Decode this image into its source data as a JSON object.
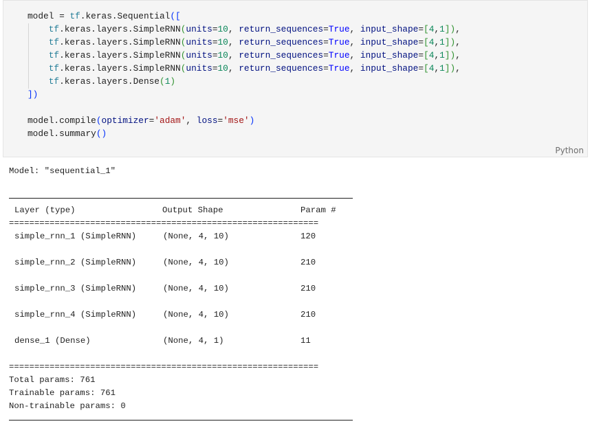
{
  "code_cell": {
    "language_label": "Python",
    "lines": [
      {
        "parts": [
          [
            "model = ",
            ""
          ],
          [
            "tf",
            "tf"
          ],
          [
            ".keras.Sequential",
            ""
          ],
          [
            "([",
            "br1"
          ]
        ]
      },
      {
        "indent": true,
        "parts": [
          [
            "tf",
            "tf"
          ],
          [
            ".keras.layers.SimpleRNN",
            ""
          ],
          [
            "(",
            "br2"
          ],
          [
            "units",
            "var"
          ],
          [
            "=",
            ""
          ],
          [
            "10",
            "num"
          ],
          [
            ", ",
            ""
          ],
          [
            "return_sequences",
            "var"
          ],
          [
            "=",
            ""
          ],
          [
            "True",
            "const"
          ],
          [
            ", ",
            ""
          ],
          [
            "input_shape",
            "var"
          ],
          [
            "=",
            ""
          ],
          [
            "[",
            "br2"
          ],
          [
            "4",
            "num"
          ],
          [
            ",",
            ""
          ],
          [
            "1",
            "num"
          ],
          [
            "]",
            "br2"
          ],
          [
            ")",
            "br2"
          ],
          [
            ",",
            ""
          ]
        ]
      },
      {
        "indent": true,
        "parts": [
          [
            "tf",
            "tf"
          ],
          [
            ".keras.layers.SimpleRNN",
            ""
          ],
          [
            "(",
            "br2"
          ],
          [
            "units",
            "var"
          ],
          [
            "=",
            ""
          ],
          [
            "10",
            "num"
          ],
          [
            ", ",
            ""
          ],
          [
            "return_sequences",
            "var"
          ],
          [
            "=",
            ""
          ],
          [
            "True",
            "const"
          ],
          [
            ", ",
            ""
          ],
          [
            "input_shape",
            "var"
          ],
          [
            "=",
            ""
          ],
          [
            "[",
            "br2"
          ],
          [
            "4",
            "num"
          ],
          [
            ",",
            ""
          ],
          [
            "1",
            "num"
          ],
          [
            "]",
            "br2"
          ],
          [
            ")",
            "br2"
          ],
          [
            ",",
            ""
          ]
        ]
      },
      {
        "indent": true,
        "parts": [
          [
            "tf",
            "tf"
          ],
          [
            ".keras.layers.SimpleRNN",
            ""
          ],
          [
            "(",
            "br2"
          ],
          [
            "units",
            "var"
          ],
          [
            "=",
            ""
          ],
          [
            "10",
            "num"
          ],
          [
            ", ",
            ""
          ],
          [
            "return_sequences",
            "var"
          ],
          [
            "=",
            ""
          ],
          [
            "True",
            "const"
          ],
          [
            ", ",
            ""
          ],
          [
            "input_shape",
            "var"
          ],
          [
            "=",
            ""
          ],
          [
            "[",
            "br2"
          ],
          [
            "4",
            "num"
          ],
          [
            ",",
            ""
          ],
          [
            "1",
            "num"
          ],
          [
            "]",
            "br2"
          ],
          [
            ")",
            "br2"
          ],
          [
            ",",
            ""
          ]
        ]
      },
      {
        "indent": true,
        "parts": [
          [
            "tf",
            "tf"
          ],
          [
            ".keras.layers.SimpleRNN",
            ""
          ],
          [
            "(",
            "br2"
          ],
          [
            "units",
            "var"
          ],
          [
            "=",
            ""
          ],
          [
            "10",
            "num"
          ],
          [
            ", ",
            ""
          ],
          [
            "return_sequences",
            "var"
          ],
          [
            "=",
            ""
          ],
          [
            "True",
            "const"
          ],
          [
            ", ",
            ""
          ],
          [
            "input_shape",
            "var"
          ],
          [
            "=",
            ""
          ],
          [
            "[",
            "br2"
          ],
          [
            "4",
            "num"
          ],
          [
            ",",
            ""
          ],
          [
            "1",
            "num"
          ],
          [
            "]",
            "br2"
          ],
          [
            ")",
            "br2"
          ],
          [
            ",",
            ""
          ]
        ]
      },
      {
        "indent": true,
        "parts": [
          [
            "tf",
            "tf"
          ],
          [
            ".keras.layers.Dense",
            ""
          ],
          [
            "(",
            "br2"
          ],
          [
            "1",
            "num"
          ],
          [
            ")",
            "br2"
          ]
        ]
      },
      {
        "parts": [
          [
            "])",
            "br1"
          ]
        ]
      },
      {
        "parts": []
      },
      {
        "parts": [
          [
            "model.compile",
            ""
          ],
          [
            "(",
            "br1"
          ],
          [
            "optimizer",
            "var"
          ],
          [
            "=",
            ""
          ],
          [
            "'adam'",
            "str"
          ],
          [
            ", ",
            ""
          ],
          [
            "loss",
            "var"
          ],
          [
            "=",
            ""
          ],
          [
            "'mse'",
            "str"
          ],
          [
            ")",
            "br1"
          ]
        ]
      },
      {
        "parts": [
          [
            "model.summary",
            ""
          ],
          [
            "()",
            "br1"
          ]
        ]
      }
    ]
  },
  "summary": {
    "model_line": "Model: \"sequential_1\"",
    "headers": {
      "layer": "Layer (type)",
      "shape": "Output Shape",
      "params": "Param #"
    },
    "separator_eq": "=============================================================",
    "rows": [
      {
        "layer": "simple_rnn_1 (SimpleRNN)",
        "shape": "(None, 4, 10)",
        "params": "120"
      },
      {
        "layer": "simple_rnn_2 (SimpleRNN)",
        "shape": "(None, 4, 10)",
        "params": "210"
      },
      {
        "layer": "simple_rnn_3 (SimpleRNN)",
        "shape": "(None, 4, 10)",
        "params": "210"
      },
      {
        "layer": "simple_rnn_4 (SimpleRNN)",
        "shape": "(None, 4, 10)",
        "params": "210"
      },
      {
        "layer": "dense_1 (Dense)",
        "shape": "(None, 4, 1)",
        "params": "11"
      }
    ],
    "total_params": "Total params: 761",
    "trainable_params": "Trainable params: 761",
    "non_trainable_params": "Non-trainable params: 0"
  }
}
